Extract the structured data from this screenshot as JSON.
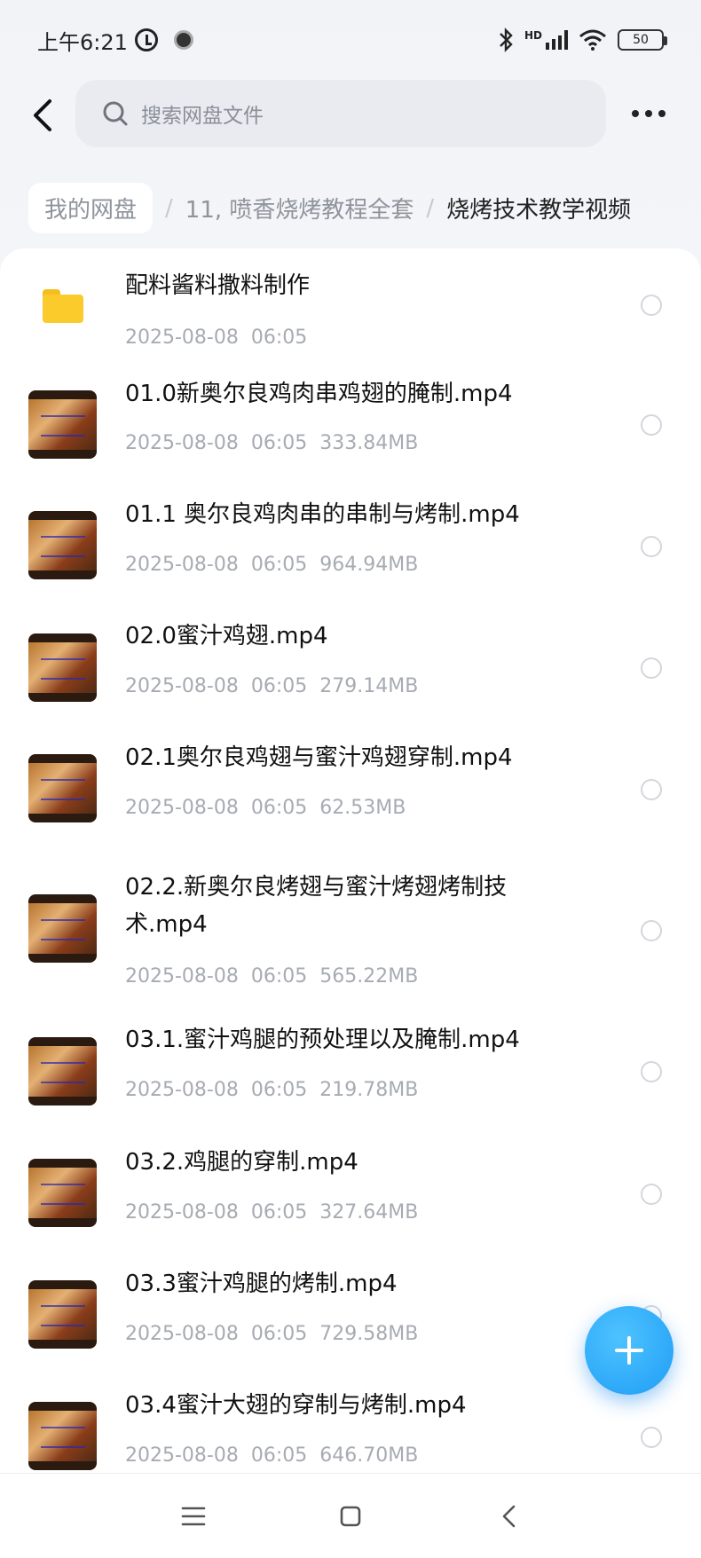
{
  "status_bar": {
    "time": "上午6:21",
    "hd": "HD",
    "battery": "50"
  },
  "top_bar": {
    "search_placeholder": "搜索网盘文件"
  },
  "breadcrumb": {
    "root": "我的网盘",
    "separator": "/",
    "middle": "11, 喷香烧烤教程全套",
    "current": "烧烤技术教学视频"
  },
  "files": [
    {
      "type": "folder",
      "name": "配料酱料撒料制作",
      "date": "2025-08-08",
      "time": "06:05",
      "size": ""
    },
    {
      "type": "video",
      "name": "01.0新奥尔良鸡肉串鸡翅的腌制.mp4",
      "date": "2025-08-08",
      "time": "06:05",
      "size": "333.84MB"
    },
    {
      "type": "video",
      "name": "01.1 奥尔良鸡肉串的串制与烤制.mp4",
      "date": "2025-08-08",
      "time": "06:05",
      "size": "964.94MB"
    },
    {
      "type": "video",
      "name": "02.0蜜汁鸡翅.mp4",
      "date": "2025-08-08",
      "time": "06:05",
      "size": "279.14MB"
    },
    {
      "type": "video",
      "name": "02.1奥尔良鸡翅与蜜汁鸡翅穿制.mp4",
      "date": "2025-08-08",
      "time": "06:05",
      "size": "62.53MB"
    },
    {
      "type": "video",
      "name": "02.2.新奥尔良烤翅与蜜汁烤翅烤制技术.mp4",
      "date": "2025-08-08",
      "time": "06:05",
      "size": "565.22MB"
    },
    {
      "type": "video",
      "name": "03.1.蜜汁鸡腿的预处理以及腌制.mp4",
      "date": "2025-08-08",
      "time": "06:05",
      "size": "219.78MB"
    },
    {
      "type": "video",
      "name": "03.2.鸡腿的穿制.mp4",
      "date": "2025-08-08",
      "time": "06:05",
      "size": "327.64MB"
    },
    {
      "type": "video",
      "name": "03.3蜜汁鸡腿的烤制.mp4",
      "date": "2025-08-08",
      "time": "06:05",
      "size": "729.58MB"
    },
    {
      "type": "video",
      "name": "03.4蜜汁大翅的穿制与烤制.mp4",
      "date": "2025-08-08",
      "time": "06:05",
      "size": "646.70MB"
    }
  ],
  "icons": {
    "back": "back-arrow-icon",
    "search": "search-icon",
    "more": "more-dots-icon",
    "fab": "plus-icon",
    "folder": "folder-icon"
  },
  "colors": {
    "accent": "#1e9df5",
    "folder": "#fbcb2c"
  }
}
